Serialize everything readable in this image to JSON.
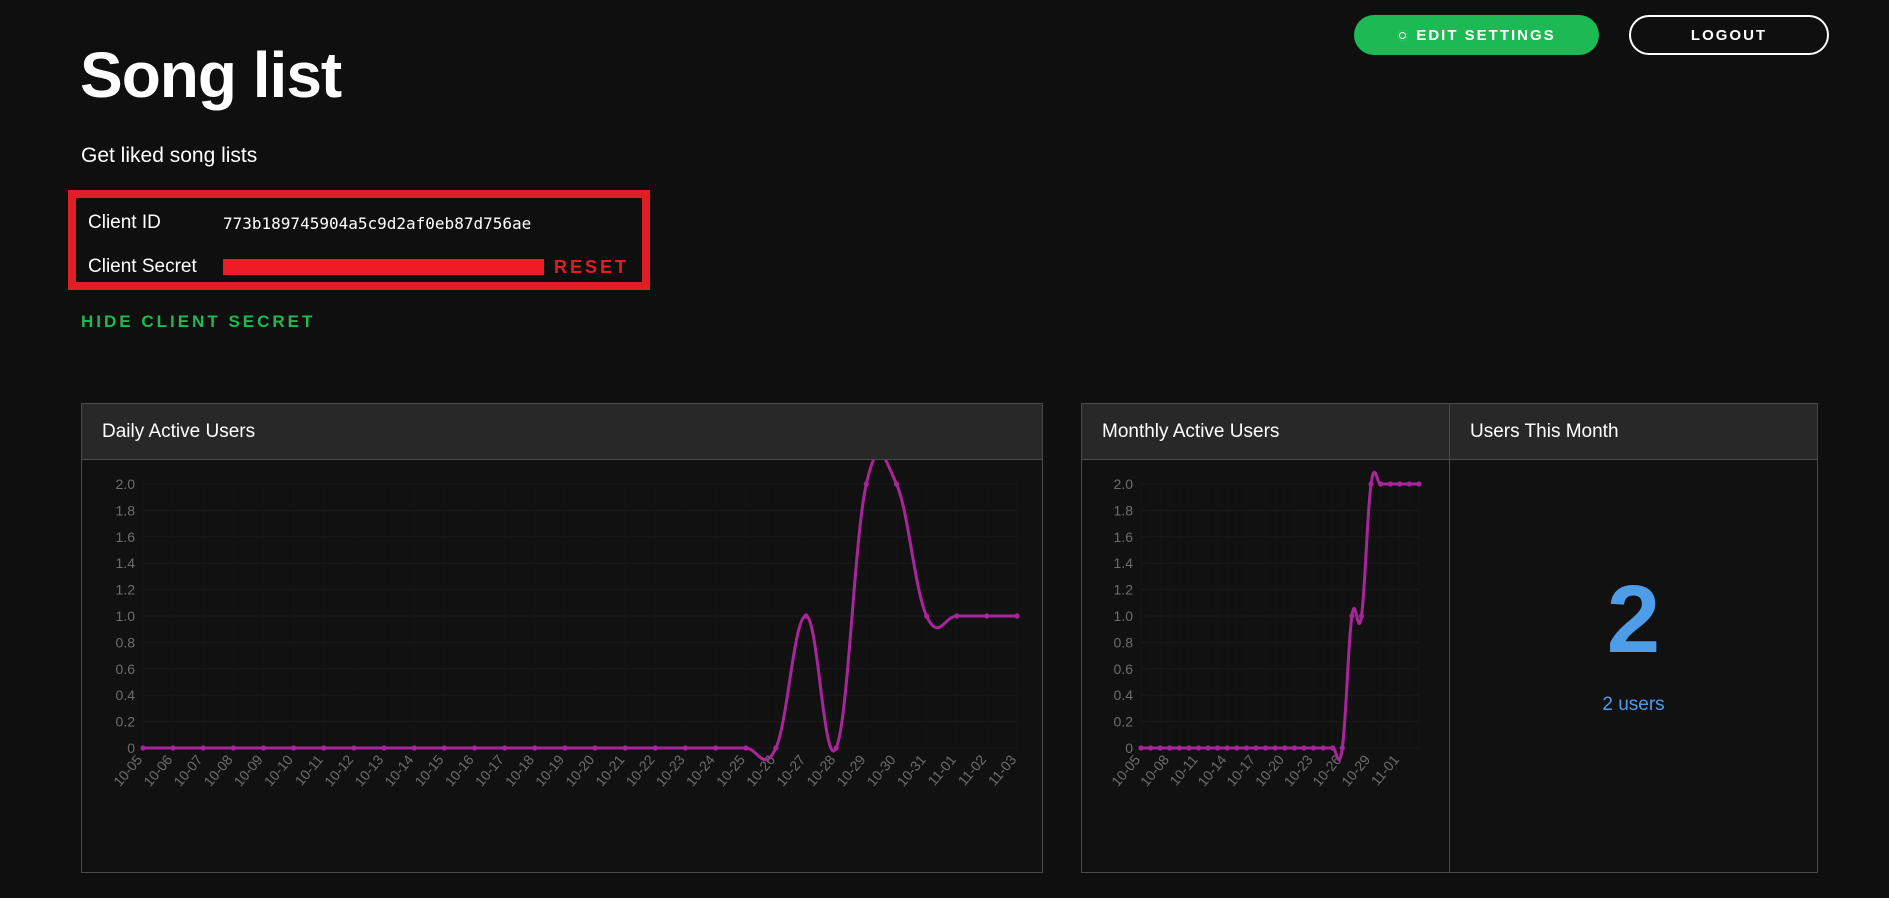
{
  "header": {
    "edit_settings_label": "EDIT SETTINGS",
    "logout_label": "LOGOUT"
  },
  "page": {
    "title": "Song list",
    "subtitle": "Get liked song lists"
  },
  "credentials": {
    "client_id_label": "Client ID",
    "client_id_value": "773b189745904a5c9d2af0eb87d756ae",
    "client_secret_label": "Client Secret",
    "reset_label": "RESET",
    "hide_secret_label": "HIDE CLIENT SECRET"
  },
  "panels": {
    "dau_title": "Daily Active Users",
    "mau_title": "Monthly Active Users",
    "users_this_month_title": "Users This Month",
    "users_this_month_value": "2",
    "users_this_month_caption": "2 users"
  },
  "colors": {
    "accent_green": "#1db954",
    "line": "#a8259a",
    "highlight_red": "#e01e26",
    "stat_blue": "#4e9de8"
  },
  "chart_data": [
    {
      "type": "line",
      "title": "Daily Active Users",
      "x": [
        "10-05",
        "10-06",
        "10-07",
        "10-08",
        "10-09",
        "10-10",
        "10-11",
        "10-12",
        "10-13",
        "10-14",
        "10-15",
        "10-16",
        "10-17",
        "10-18",
        "10-19",
        "10-20",
        "10-21",
        "10-22",
        "10-23",
        "10-24",
        "10-25",
        "10-26",
        "10-27",
        "10-28",
        "10-29",
        "10-30",
        "10-31",
        "11-01",
        "11-02",
        "11-03"
      ],
      "values": [
        0,
        0,
        0,
        0,
        0,
        0,
        0,
        0,
        0,
        0,
        0,
        0,
        0,
        0,
        0,
        0,
        0,
        0,
        0,
        0,
        0,
        0,
        1,
        0,
        2,
        2,
        1,
        1,
        1,
        1
      ],
      "yticks": [
        "0",
        "0.2",
        "0.4",
        "0.6",
        "0.8",
        "1.0",
        "1.2",
        "1.4",
        "1.6",
        "1.8",
        "2.0"
      ],
      "ylim": [
        0,
        2
      ],
      "grid": true
    },
    {
      "type": "line",
      "title": "Monthly Active Users",
      "x": [
        "10-05",
        "10-06",
        "10-07",
        "10-08",
        "10-09",
        "10-10",
        "10-11",
        "10-12",
        "10-13",
        "10-14",
        "10-15",
        "10-16",
        "10-17",
        "10-18",
        "10-19",
        "10-20",
        "10-21",
        "10-22",
        "10-23",
        "10-24",
        "10-25",
        "10-26",
        "10-27",
        "10-28",
        "10-29",
        "10-30",
        "10-31",
        "11-01",
        "11-02",
        "11-03"
      ],
      "xticks": [
        "10-05",
        "10-08",
        "10-11",
        "10-14",
        "10-17",
        "10-20",
        "10-23",
        "10-26",
        "10-29",
        "11-01"
      ],
      "values": [
        0,
        0,
        0,
        0,
        0,
        0,
        0,
        0,
        0,
        0,
        0,
        0,
        0,
        0,
        0,
        0,
        0,
        0,
        0,
        0,
        0,
        0,
        1,
        1,
        2,
        2,
        2,
        2,
        2,
        2
      ],
      "yticks": [
        "0",
        "0.2",
        "0.4",
        "0.6",
        "0.8",
        "1.0",
        "1.2",
        "1.4",
        "1.6",
        "1.8",
        "2.0"
      ],
      "ylim": [
        0,
        2
      ],
      "grid": true
    }
  ]
}
